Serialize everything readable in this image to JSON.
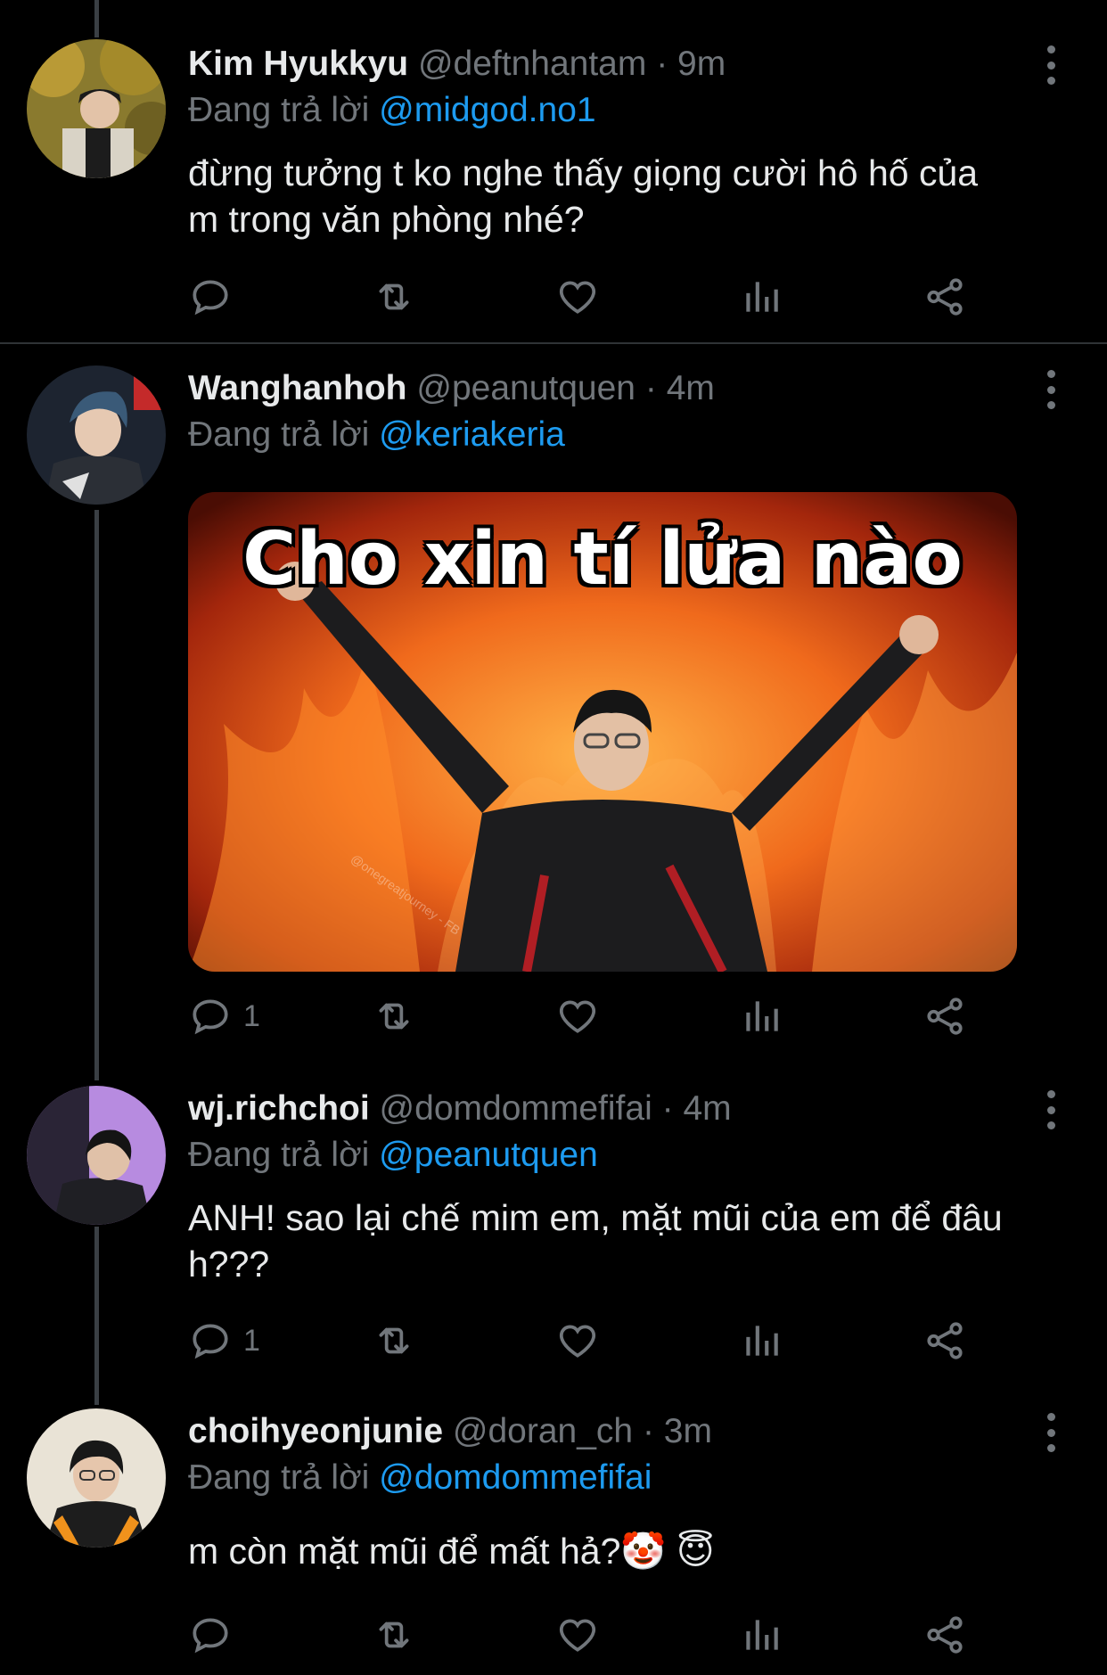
{
  "tweets": [
    {
      "name": "Kim Hyukkyu",
      "handle": "@deftnhantam",
      "time": "9m",
      "reply_prefix": "Đang trả lời",
      "reply_to": "@midgod.no1",
      "text_line1": "đừng tưởng t ko nghe thấy giọng cười hô hố của",
      "text_line2": "m trong văn phòng nhé?",
      "reply_count": ""
    },
    {
      "name": "Wanghanhoh",
      "handle": "@peanutquen",
      "time": "4m",
      "reply_prefix": "Đang trả lời",
      "reply_to": "@keriakeria",
      "media_caption": "Cho xin tí lửa nào",
      "media_watermark": "@onegreatjourney - FB",
      "reply_count": "1"
    },
    {
      "name": "wj.richchoi",
      "handle": "@domdommefifai",
      "time": "4m",
      "reply_prefix": "Đang trả lời",
      "reply_to": "@peanutquen",
      "text_line1": "ANH! sao lại chế mim em, mặt mũi của em để đâu",
      "text_line2": "h???",
      "reply_count": "1"
    },
    {
      "name": "choihyeonjunie",
      "handle": "@doran_ch",
      "time": "3m",
      "reply_prefix": "Đang trả lời",
      "reply_to": "@domdommefifai",
      "text_line1": "m còn mặt mũi để mất hả?🤡 😇",
      "reply_count": ""
    }
  ],
  "separator": "·",
  "icons": {
    "reply": "reply-icon",
    "retweet": "retweet-icon",
    "like": "heart-icon",
    "views": "views-icon",
    "share": "share-icon",
    "more": "more-vertical-icon"
  },
  "colors": {
    "background": "#000000",
    "text": "#e7e9ea",
    "muted": "#71767b",
    "link": "#1d9bf0"
  }
}
